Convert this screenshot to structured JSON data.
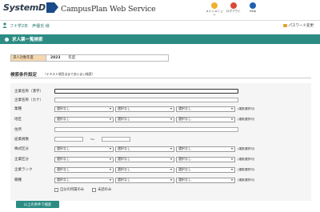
{
  "header": {
    "logo_text": "SystemD",
    "brand": "CampusPlan Web Service",
    "icons": [
      {
        "name": "menu-icon",
        "label": "メインメニュー",
        "color": "#f0b030"
      },
      {
        "name": "logout-icon",
        "label": "ログアウト",
        "color": "#d94a3a"
      },
      {
        "name": "help-icon",
        "label": "Help",
        "color": "#2060b0"
      }
    ]
  },
  "subbar": {
    "user": "フナ学2年　声優氏 様",
    "password_link": "パスワード変更"
  },
  "page_title": "求人票一覧検索",
  "year": {
    "label": "求人対象年度",
    "value": "2023",
    "unit": "年度"
  },
  "conditions": {
    "title": "検索条件設定",
    "note": "（テキスト項目はまであいまい検索）"
  },
  "form": {
    "company_name_label": "企業名称（漢字）",
    "company_kana_label": "企業名称（カナ）",
    "industry_label": "業種",
    "region_label": "地区",
    "address_label": "住所",
    "employees_label": "従業員数",
    "range_sep": "～",
    "stock_label": "株式区分",
    "company_type_label": "企業区分",
    "rank_label": "企業ランク",
    "job_label": "職種",
    "select_default": "選択なし",
    "multi_note": "(複数選択可)",
    "own_only": "自分の所属のみ",
    "unread_only": "未読のみ"
  },
  "search_button": "以上の条件で検索"
}
